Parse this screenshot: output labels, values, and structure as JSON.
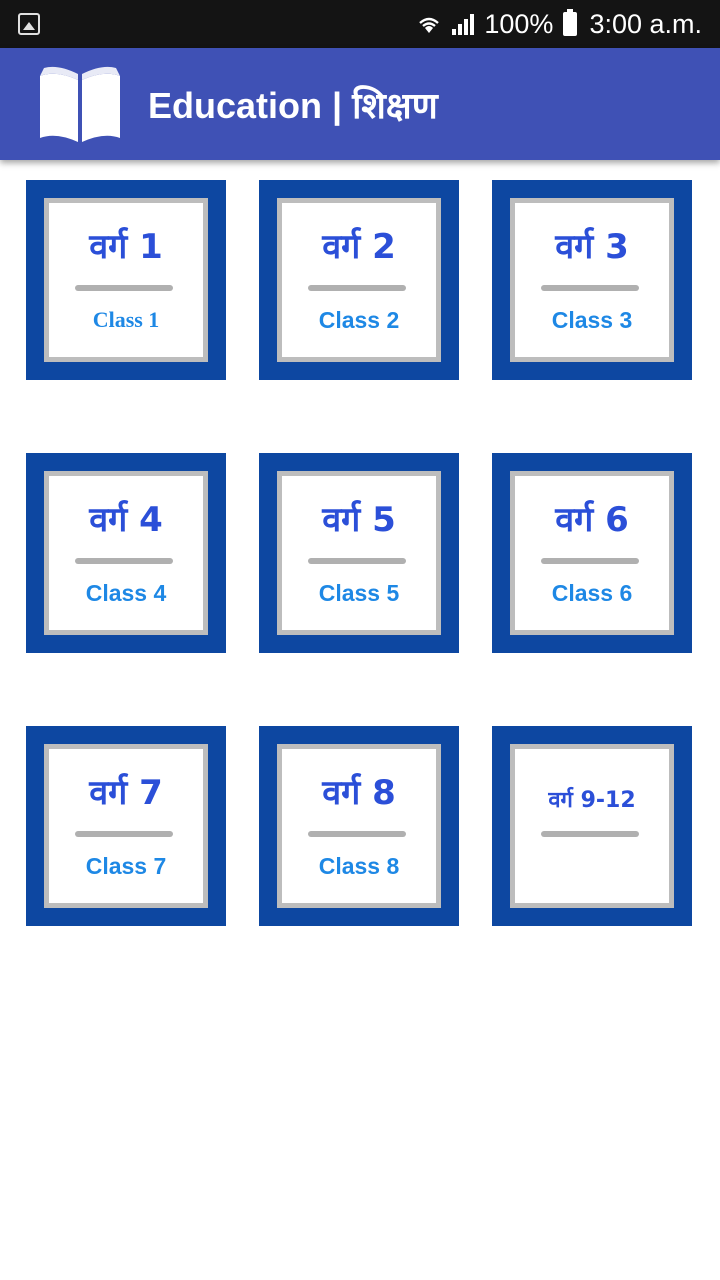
{
  "status_bar": {
    "battery": "100%",
    "time": "3:00 a.m.",
    "icons": [
      "gallery-icon",
      "wifi-icon",
      "signal-icon",
      "battery-icon"
    ]
  },
  "app_bar": {
    "title": "Education  |  शिक्षण",
    "icon": "book-icon",
    "color": "#3f51b5"
  },
  "tiles": [
    {
      "hindi": "वर्ग 1",
      "english": "Class 1"
    },
    {
      "hindi": "वर्ग 2",
      "english": "Class 2"
    },
    {
      "hindi": "वर्ग 3",
      "english": "Class 3"
    },
    {
      "hindi": "वर्ग 4",
      "english": "Class 4"
    },
    {
      "hindi": "वर्ग 5",
      "english": "Class 5"
    },
    {
      "hindi": "वर्ग 6",
      "english": "Class 6"
    },
    {
      "hindi": "वर्ग 7",
      "english": "Class 7"
    },
    {
      "hindi": "वर्ग 8",
      "english": "Class 8"
    },
    {
      "hindi": "वर्ग 9-12",
      "english": ""
    }
  ],
  "colors": {
    "tile_border": "#0d47a1",
    "hindi_text": "#2b4fd8",
    "english_text": "#1e88e5"
  }
}
